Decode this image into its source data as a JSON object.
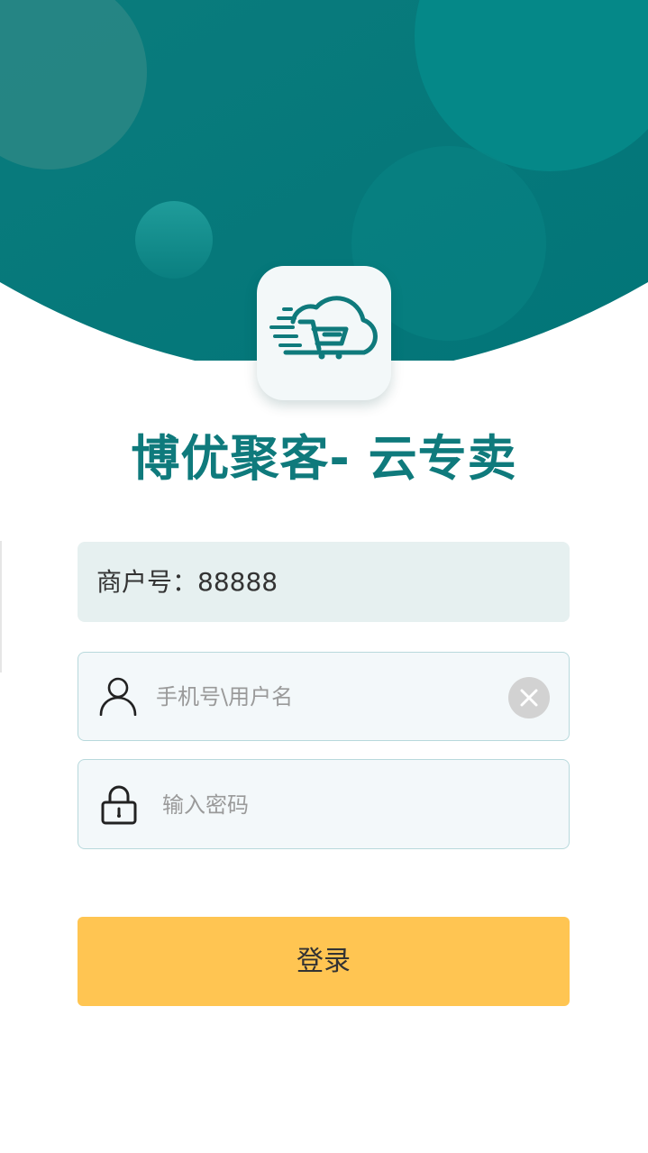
{
  "brand": {
    "title": "博优聚客- 云专卖"
  },
  "merchant": {
    "label": "商户号：88888"
  },
  "username": {
    "placeholder": "手机号\\用户名",
    "value": ""
  },
  "password": {
    "placeholder": "输入密码",
    "value": ""
  },
  "login": {
    "label": "登录"
  },
  "icons": {
    "logo": "cloud-cart-icon",
    "user": "user-icon",
    "lock": "lock-icon",
    "clear": "close-icon"
  },
  "colors": {
    "primary": "#0f7a7c",
    "hero": "#037a7d",
    "accent_button": "#ffc552",
    "merchant_field_bg": "#e6f0f0",
    "field_bg": "#f3f8fa",
    "field_border": "#b8d9dc"
  }
}
